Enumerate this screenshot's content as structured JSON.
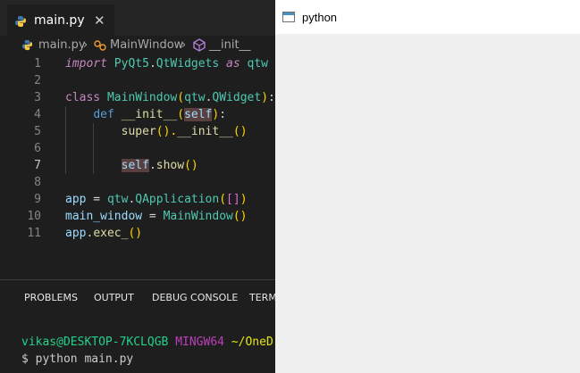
{
  "editor": {
    "tab": {
      "label": "main.py",
      "close": "✕"
    },
    "breadcrumb": {
      "file": "main.py",
      "sep1": "›",
      "class": "MainWindow",
      "sep2": "›",
      "method": "__init__"
    },
    "lines": [
      {
        "n": "1",
        "tokens": [
          [
            "import",
            "kw-it"
          ],
          [
            " ",
            "plain"
          ],
          [
            "PyQt5",
            "cls"
          ],
          [
            ".",
            "plain"
          ],
          [
            "QtWidgets",
            "cls"
          ],
          [
            " ",
            "plain"
          ],
          [
            "as",
            "kw-it"
          ],
          [
            " ",
            "plain"
          ],
          [
            "qtw",
            "cls"
          ]
        ]
      },
      {
        "n": "2",
        "tokens": []
      },
      {
        "n": "3",
        "tokens": [
          [
            "class",
            "kw"
          ],
          [
            " ",
            "plain"
          ],
          [
            "MainWindow",
            "cls"
          ],
          [
            "(",
            "br1"
          ],
          [
            "qtw",
            "cls"
          ],
          [
            ".",
            "plain"
          ],
          [
            "QWidget",
            "cls"
          ],
          [
            ")",
            "br1"
          ],
          [
            ":",
            "plain"
          ]
        ]
      },
      {
        "n": "4",
        "tokens": [
          [
            "    ",
            "plain"
          ],
          [
            "def",
            "kwb"
          ],
          [
            " ",
            "plain"
          ],
          [
            "__init__",
            "fn"
          ],
          [
            "(",
            "br1"
          ],
          [
            "self",
            "var hl"
          ],
          [
            ")",
            "br1"
          ],
          [
            ":",
            "plain"
          ]
        ]
      },
      {
        "n": "5",
        "tokens": [
          [
            "        ",
            "plain"
          ],
          [
            "super",
            "fn"
          ],
          [
            "().",
            "br1"
          ],
          [
            "__init__",
            "fn"
          ],
          [
            "()",
            "br1"
          ]
        ]
      },
      {
        "n": "6",
        "tokens": []
      },
      {
        "n": "7",
        "tokens": [
          [
            "        ",
            "plain"
          ],
          [
            "self",
            "var hl"
          ],
          [
            ".",
            "plain"
          ],
          [
            "show",
            "fn"
          ],
          [
            "()",
            "br1"
          ]
        ]
      },
      {
        "n": "8",
        "tokens": []
      },
      {
        "n": "9",
        "tokens": [
          [
            "app",
            "var"
          ],
          [
            " = ",
            "plain"
          ],
          [
            "qtw",
            "cls"
          ],
          [
            ".",
            "plain"
          ],
          [
            "QApplication",
            "cls"
          ],
          [
            "(",
            "br1"
          ],
          [
            "[]",
            "br2"
          ],
          [
            ")",
            "br1"
          ]
        ]
      },
      {
        "n": "10",
        "tokens": [
          [
            "main_window",
            "var"
          ],
          [
            " = ",
            "plain"
          ],
          [
            "MainWindow",
            "cls"
          ],
          [
            "()",
            "br1"
          ]
        ]
      },
      {
        "n": "11",
        "tokens": [
          [
            "app",
            "var"
          ],
          [
            ".",
            "plain"
          ],
          [
            "exec_",
            "fn"
          ],
          [
            "()",
            "br1"
          ]
        ]
      }
    ],
    "active_line": "7"
  },
  "panel": {
    "tabs": [
      "PROBLEMS",
      "OUTPUT",
      "DEBUG CONSOLE",
      "TERMINAL"
    ],
    "terminal": {
      "user_host": "vikas@DESKTOP-7KCLQGB",
      "shell": "MINGW64",
      "path": "~/OneDrive/",
      "prompt": "$",
      "command": "python main.py"
    }
  },
  "python_window": {
    "title": "python"
  },
  "colors": {
    "editor_bg": "#1e1e1e",
    "window_bg": "#f0f0f0",
    "titlebar_bg": "#ffffff"
  }
}
